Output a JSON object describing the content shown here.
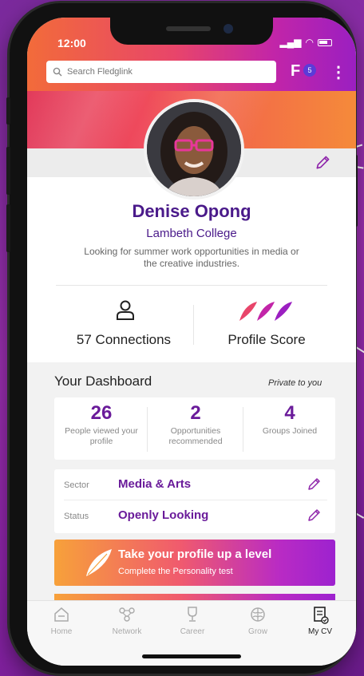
{
  "status_bar": {
    "time": "12:00"
  },
  "search": {
    "placeholder": "Search Fledglink"
  },
  "header": {
    "filter_badge": "5"
  },
  "profile": {
    "name": "Denise Opong",
    "college": "Lambeth College",
    "bio": "Looking for summer work opportunities in media or the creative industries."
  },
  "connections": {
    "label": "57 Connections"
  },
  "score": {
    "label": "Profile Score"
  },
  "dashboard": {
    "title": "Your Dashboard",
    "privacy": "Private to you",
    "stats": [
      {
        "value": "26",
        "label": "People viewed your profile"
      },
      {
        "value": "2",
        "label": "Opportunities recommended"
      },
      {
        "value": "4",
        "label": "Groups Joined"
      }
    ],
    "sector": {
      "label": "Sector",
      "value": "Media & Arts"
    },
    "status": {
      "label": "Status",
      "value": "Openly Looking"
    }
  },
  "cta": {
    "title": "Take your profile up a level",
    "subtitle": "Complete the Personality test"
  },
  "tabs": [
    {
      "label": "Home",
      "icon": "home-icon"
    },
    {
      "label": "Network",
      "icon": "network-icon"
    },
    {
      "label": "Career",
      "icon": "trophy-icon"
    },
    {
      "label": "Grow",
      "icon": "brain-icon"
    },
    {
      "label": "My CV",
      "icon": "cv-icon",
      "active": true
    }
  ],
  "colors": {
    "primary": "#6a1b9a",
    "header_start": "#f26b3a",
    "header_end": "#9b1fc1"
  }
}
